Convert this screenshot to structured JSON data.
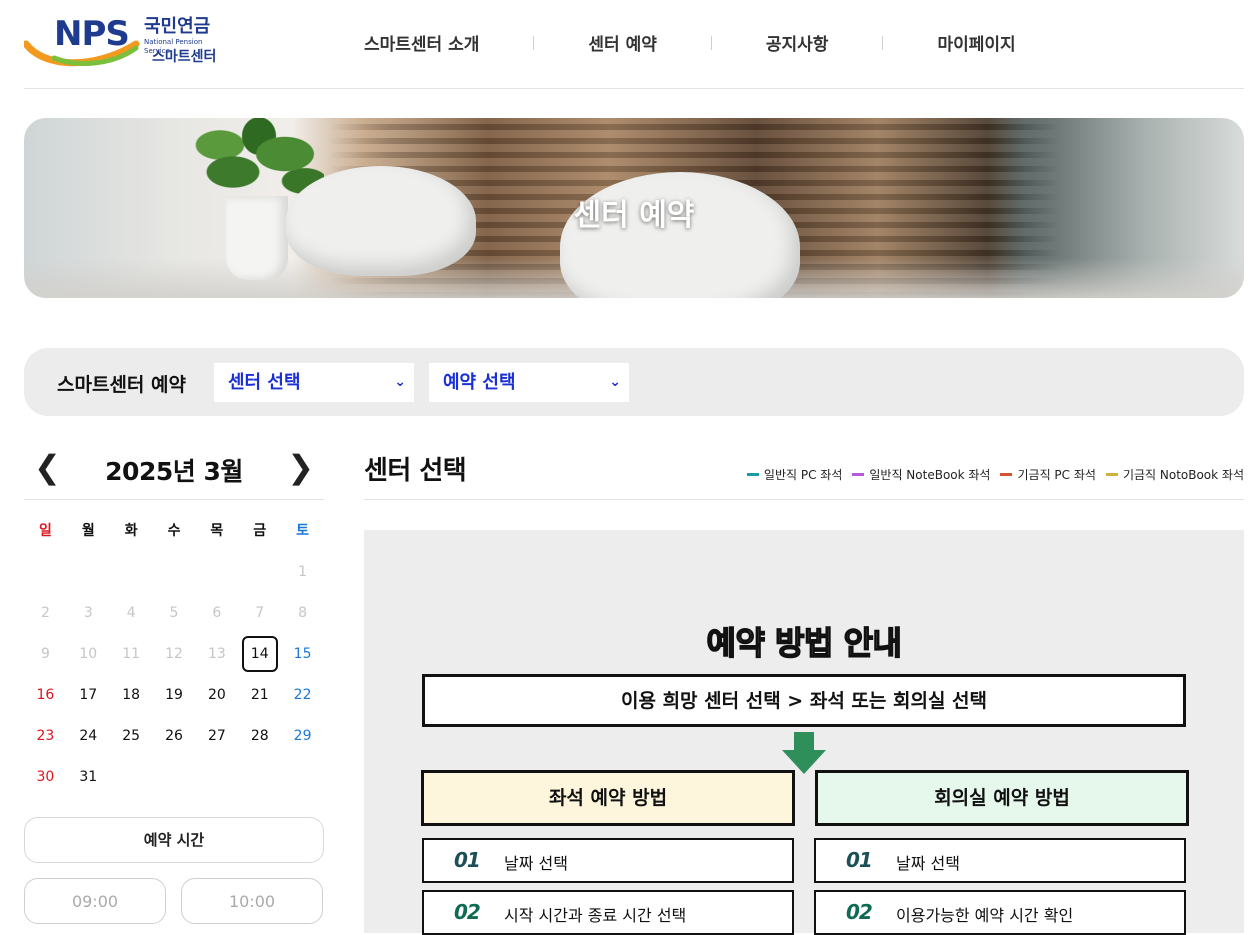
{
  "header": {
    "logo": {
      "brand": "NPS",
      "name_kr": "국민연금",
      "name_en": "National Pension Service",
      "subtitle": "스마트센터"
    },
    "nav": [
      "스마트센터 소개",
      "센터 예약",
      "공지사항",
      "마이페이지"
    ]
  },
  "banner": {
    "title": "센터 예약"
  },
  "searchbar": {
    "label": "스마트센터 예약",
    "center_select": "센터 선택",
    "reserve_select": "예약 선택"
  },
  "calendar": {
    "title": "2025년 3월",
    "weekdays": [
      "일",
      "월",
      "화",
      "수",
      "목",
      "금",
      "토"
    ],
    "weeks": [
      [
        "",
        "",
        "",
        "",
        "",
        "",
        "1"
      ],
      [
        "2",
        "3",
        "4",
        "5",
        "6",
        "7",
        "8"
      ],
      [
        "9",
        "10",
        "11",
        "12",
        "13",
        "14",
        "15"
      ],
      [
        "16",
        "17",
        "18",
        "19",
        "20",
        "21",
        "22"
      ],
      [
        "23",
        "24",
        "25",
        "26",
        "27",
        "28",
        "29"
      ],
      [
        "30",
        "31",
        "",
        "",
        "",
        "",
        ""
      ]
    ],
    "selected_day": "14",
    "disabled_until_day": 13
  },
  "time": {
    "title": "예약 시간",
    "slots": [
      "09:00",
      "10:00"
    ]
  },
  "main": {
    "title": "센터 선택",
    "legend": [
      {
        "label": "일반직 PC 좌석",
        "color": "#1a9aa3"
      },
      {
        "label": "일반직 NoteBook 좌석",
        "color": "#b25ad8"
      },
      {
        "label": "기금직 PC 좌석",
        "color": "#d4542b"
      },
      {
        "label": "기금직 NotoBook 좌석",
        "color": "#d3b03c"
      }
    ]
  },
  "guide": {
    "title": "예약 방법 안내",
    "step": "이용 희망 센터 선택 > 좌석 또는 회의실 선택",
    "seat": {
      "title": "좌석 예약 방법",
      "items": [
        {
          "num": "01",
          "text": "날짜 선택"
        },
        {
          "num": "02",
          "text": "시작 시간과 종료 시간 선택"
        }
      ]
    },
    "room": {
      "title": "회의실 예약 방법",
      "items": [
        {
          "num": "01",
          "text": "날짜 선택"
        },
        {
          "num": "02",
          "text": "이용가능한 예약 시간 확인"
        }
      ]
    }
  }
}
